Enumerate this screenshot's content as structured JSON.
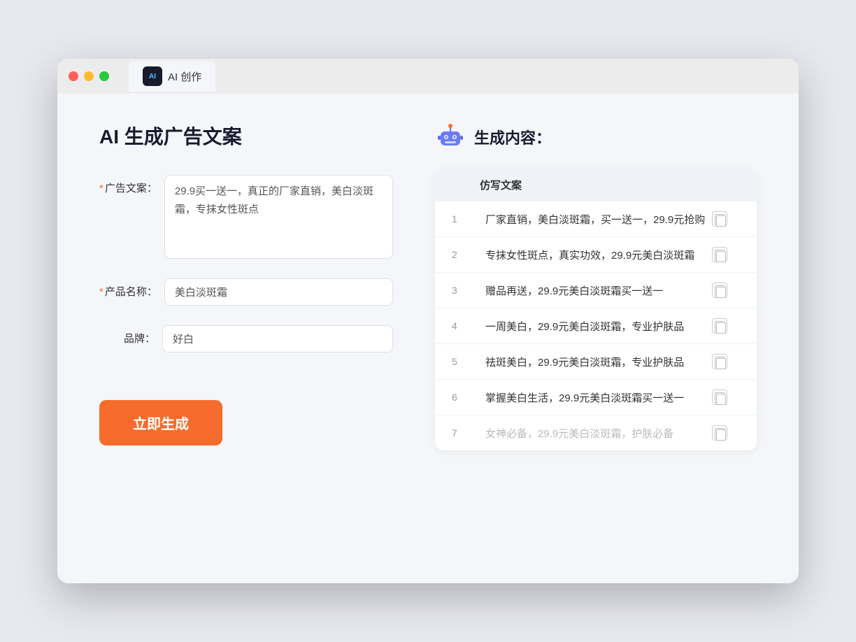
{
  "window": {
    "tab_label": "AI 创作",
    "traffic_lights": [
      "red",
      "yellow",
      "green"
    ]
  },
  "left_panel": {
    "title": "AI 生成广告文案",
    "form": {
      "ad_copy_label": "广告文案：",
      "ad_copy_required": "*",
      "ad_copy_value": "29.9买一送一，真正的厂家直销，美白淡斑霜，专抹女性斑点",
      "product_name_label": "产品名称：",
      "product_name_required": "*",
      "product_name_value": "美白淡斑霜",
      "brand_label": "品牌：",
      "brand_value": "好白"
    },
    "generate_button": "立即生成"
  },
  "right_panel": {
    "title": "生成内容：",
    "table_header": "仿写文案",
    "rows": [
      {
        "num": "1",
        "text": "厂家直销，美白淡斑霜，买一送一，29.9元抢购",
        "dimmed": false
      },
      {
        "num": "2",
        "text": "专抹女性斑点，真实功效，29.9元美白淡斑霜",
        "dimmed": false
      },
      {
        "num": "3",
        "text": "赠品再送，29.9元美白淡斑霜买一送一",
        "dimmed": false
      },
      {
        "num": "4",
        "text": "一周美白，29.9元美白淡斑霜，专业护肤品",
        "dimmed": false
      },
      {
        "num": "5",
        "text": "祛斑美白，29.9元美白淡斑霜，专业护肤品",
        "dimmed": false
      },
      {
        "num": "6",
        "text": "掌握美白生活，29.9元美白淡斑霜买一送一",
        "dimmed": false
      },
      {
        "num": "7",
        "text": "女神必备，29.9元美白淡斑霜，护肤必备",
        "dimmed": true
      }
    ]
  }
}
